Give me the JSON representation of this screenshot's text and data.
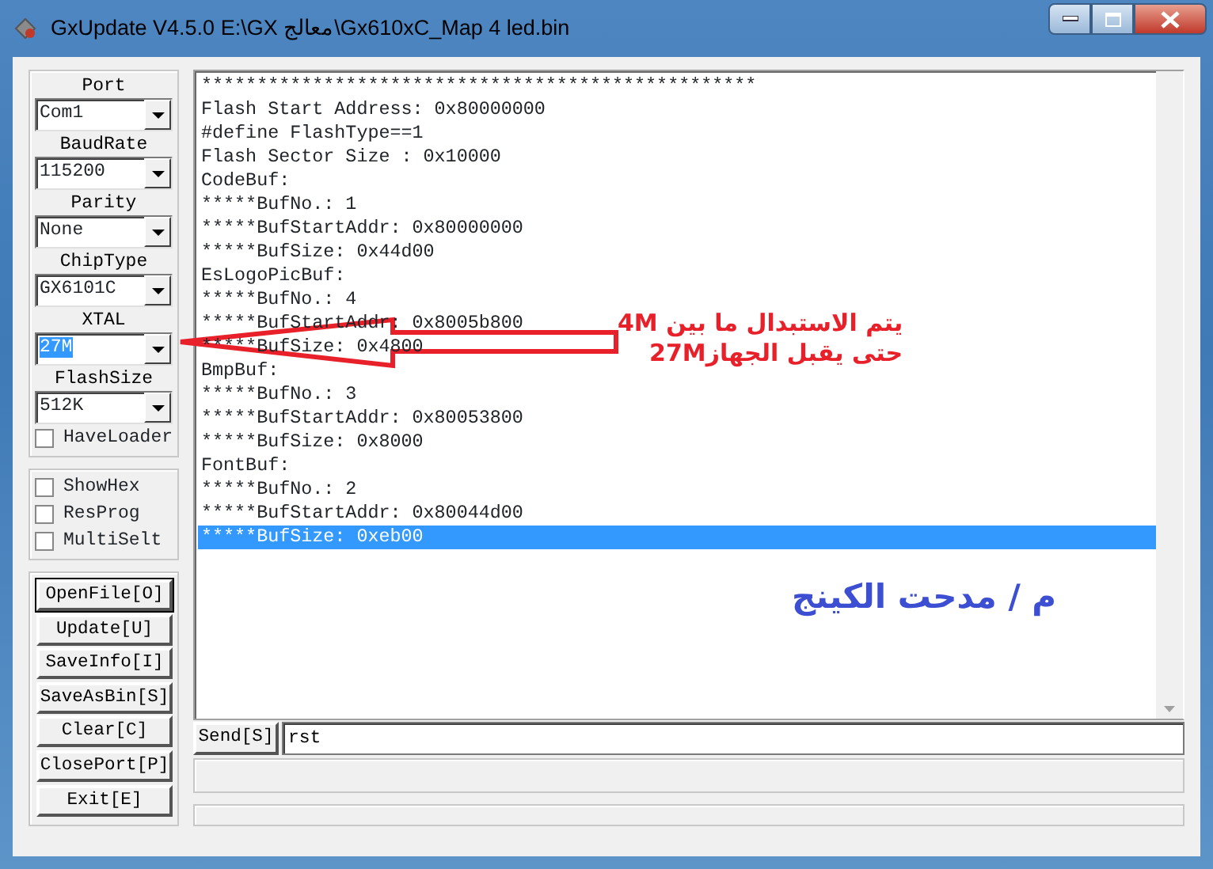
{
  "window": {
    "title": "GxUpdate V4.5.0 E:\\GX معالج\\Gx610xC_Map 4 led.bin"
  },
  "settings": [
    {
      "label": "Port",
      "value": "Com1",
      "selected": false
    },
    {
      "label": "BaudRate",
      "value": "115200",
      "selected": false
    },
    {
      "label": "Parity",
      "value": "None",
      "selected": false
    },
    {
      "label": "ChipType",
      "value": "GX6101C",
      "selected": false
    },
    {
      "label": "XTAL",
      "value": "27M",
      "selected": true
    },
    {
      "label": "FlashSize",
      "value": "512K",
      "selected": false
    }
  ],
  "have_loader": {
    "label": "HaveLoader",
    "checked": false
  },
  "options": [
    {
      "label": "ShowHex",
      "checked": false
    },
    {
      "label": "ResProg",
      "checked": false
    },
    {
      "label": "MultiSelt",
      "checked": false
    }
  ],
  "buttons": [
    {
      "label": "OpenFile[O]",
      "default": true
    },
    {
      "label": "Update[U]",
      "default": false
    },
    {
      "label": "SaveInfo[I]",
      "default": false
    },
    {
      "label": "SaveAsBin[S]",
      "default": false
    },
    {
      "label": "Clear[C]",
      "default": false
    },
    {
      "label": "ClosePort[P]",
      "default": false
    },
    {
      "label": "Exit[E]",
      "default": false
    }
  ],
  "log": [
    {
      "text": "**************************************************",
      "selected": false
    },
    {
      "text": "Flash Start Address: 0x80000000",
      "selected": false
    },
    {
      "text": "#define FlashType==1",
      "selected": false
    },
    {
      "text": "Flash Sector Size : 0x10000",
      "selected": false
    },
    {
      "text": "CodeBuf:",
      "selected": false
    },
    {
      "text": "*****BufNo.: 1",
      "selected": false
    },
    {
      "text": "*****BufStartAddr: 0x80000000",
      "selected": false
    },
    {
      "text": "*****BufSize: 0x44d00",
      "selected": false
    },
    {
      "text": "EsLogoPicBuf:",
      "selected": false
    },
    {
      "text": "*****BufNo.: 4",
      "selected": false
    },
    {
      "text": "*****BufStartAddr: 0x8005b800",
      "selected": false
    },
    {
      "text": "*****BufSize: 0x4800",
      "selected": false
    },
    {
      "text": "BmpBuf:",
      "selected": false
    },
    {
      "text": "*****BufNo.: 3",
      "selected": false
    },
    {
      "text": "*****BufStartAddr: 0x80053800",
      "selected": false
    },
    {
      "text": "*****BufSize: 0x8000",
      "selected": false
    },
    {
      "text": "FontBuf:",
      "selected": false
    },
    {
      "text": "*****BufNo.: 2",
      "selected": false
    },
    {
      "text": "*****BufStartAddr: 0x80044d00",
      "selected": false
    },
    {
      "text": "*****BufSize: 0xeb00",
      "selected": true
    }
  ],
  "send": {
    "button": "Send[S]",
    "value": "rst"
  },
  "annotations": [
    {
      "kind": "note",
      "lines": [
        "يتم الاستبدال ما بين 4M",
        "حتى يقبل الجهاز27M"
      ],
      "color": "#e8202a"
    },
    {
      "kind": "signature",
      "lines": [
        "م / مدحت الكينج"
      ],
      "color": "#3c4fd2"
    }
  ]
}
